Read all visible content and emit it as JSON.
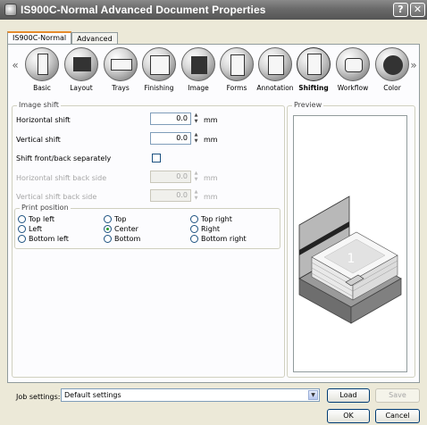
{
  "window": {
    "title": "IS900C-Normal Advanced Document Properties",
    "help_label": "?",
    "close_label": "✕"
  },
  "tabs": [
    {
      "label": "IS900C-Normal",
      "active": true
    },
    {
      "label": "Advanced",
      "active": false
    }
  ],
  "nav": {
    "left": "«",
    "right": "»"
  },
  "categories": [
    {
      "label": "Basic",
      "icon": "basic-icon"
    },
    {
      "label": "Layout",
      "icon": "layout-icon"
    },
    {
      "label": "Trays",
      "icon": "trays-icon"
    },
    {
      "label": "Finishing",
      "icon": "finishing-icon"
    },
    {
      "label": "Image",
      "icon": "image-icon"
    },
    {
      "label": "Forms",
      "icon": "forms-icon"
    },
    {
      "label": "Annotation",
      "icon": "annotation-icon"
    },
    {
      "label": "Shifting",
      "icon": "shifting-icon",
      "selected": true
    },
    {
      "label": "Workflow",
      "icon": "workflow-icon"
    },
    {
      "label": "Color",
      "icon": "color-icon"
    }
  ],
  "image_shift": {
    "group_title": "Image shift",
    "horizontal_shift": {
      "label": "Horizontal shift",
      "value": "0.0",
      "unit": "mm"
    },
    "vertical_shift": {
      "label": "Vertical shift",
      "value": "0.0",
      "unit": "mm"
    },
    "separately": {
      "label": "Shift front/back separately",
      "checked": false
    },
    "horizontal_back": {
      "label": "Horizontal shift back side",
      "value": "0.0",
      "unit": "mm"
    },
    "vertical_back": {
      "label": "Vertical shift back side",
      "value": "0.0",
      "unit": "mm"
    }
  },
  "print_position": {
    "group_title": "Print position",
    "options": [
      {
        "label": "Top left",
        "selected": false
      },
      {
        "label": "Top",
        "selected": false
      },
      {
        "label": "Top right",
        "selected": false
      },
      {
        "label": "Left",
        "selected": false
      },
      {
        "label": "Center",
        "selected": true
      },
      {
        "label": "Right",
        "selected": false
      },
      {
        "label": "Bottom left",
        "selected": false
      },
      {
        "label": "Bottom",
        "selected": false
      },
      {
        "label": "Bottom right",
        "selected": false
      }
    ]
  },
  "preview": {
    "title": "Preview",
    "page_number": "1"
  },
  "job_settings": {
    "label": "Job settings:",
    "value": "Default settings",
    "load_label": "Load",
    "save_label": "Save"
  },
  "footer": {
    "ok_label": "OK",
    "cancel_label": "Cancel"
  },
  "colors": {
    "title_bar": "#6a6a6a",
    "tab_highlight": "#e68b2c",
    "preview_paper": "#e8e8e8"
  }
}
